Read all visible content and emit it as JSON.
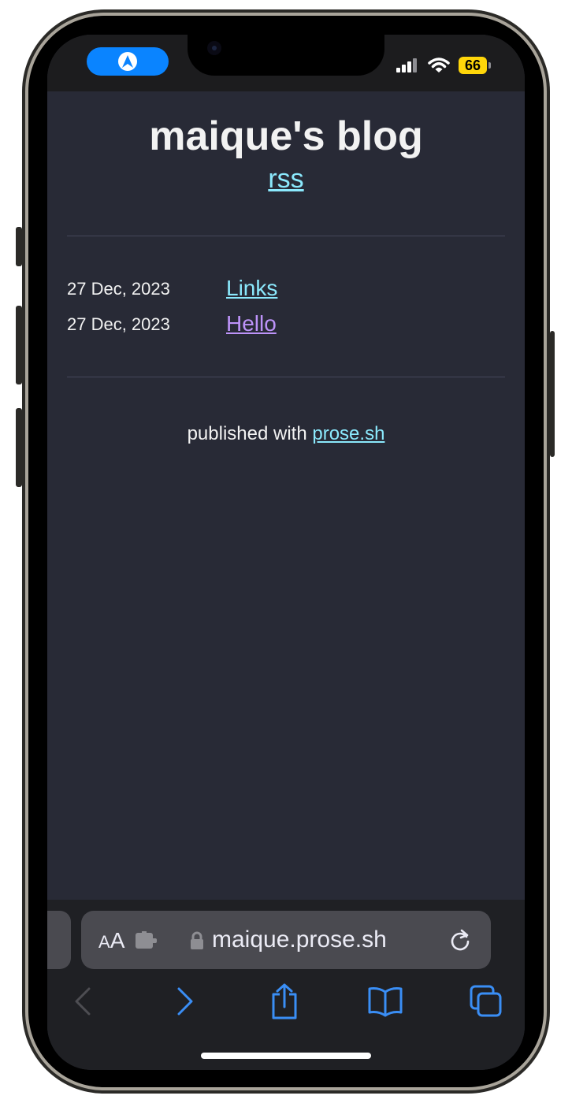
{
  "status_bar": {
    "battery_level": "66",
    "battery_color": "#ffd60a",
    "nav_pill_color": "#0a84ff"
  },
  "blog": {
    "title": "maique's blog",
    "rss_label": "rss",
    "posts": [
      {
        "date": "27 Dec, 2023",
        "title": "Links",
        "link_color": "#8be9fd"
      },
      {
        "date": "27 Dec, 2023",
        "title": "Hello",
        "link_color": "#bd93f9"
      }
    ],
    "footer_prefix": "published with",
    "footer_link": "prose.sh"
  },
  "safari": {
    "reader_label_small": "A",
    "reader_label_big": "A",
    "url": "maique.prose.sh",
    "icons": [
      "text-size-icon",
      "extension-icon",
      "lock-icon",
      "reload-icon",
      "back-icon",
      "forward-icon",
      "share-icon",
      "bookmarks-icon",
      "tabs-icon"
    ]
  }
}
